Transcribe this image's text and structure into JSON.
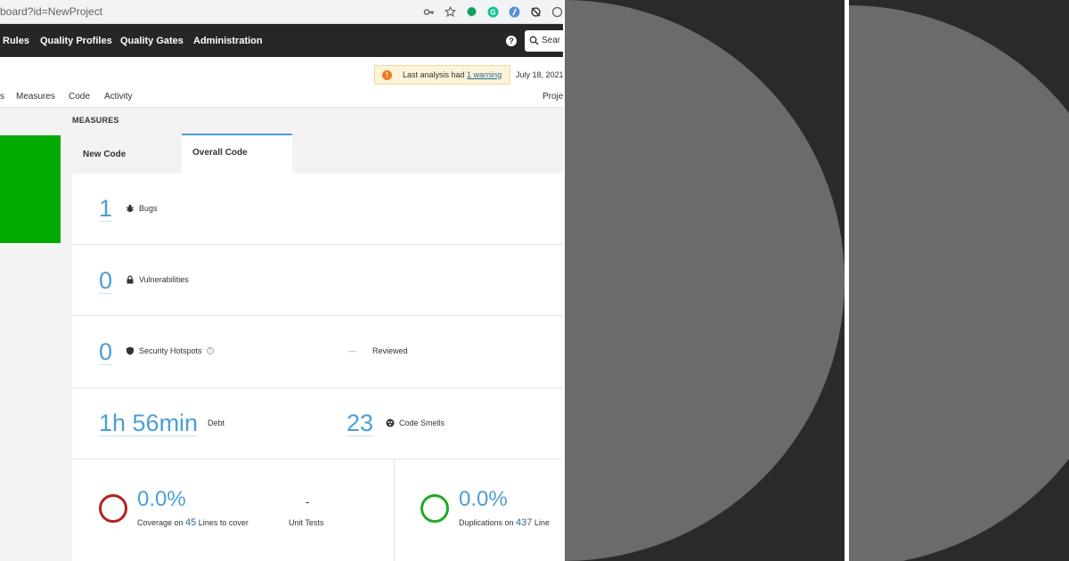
{
  "browser": {
    "url": "board?id=NewProject"
  },
  "nav": {
    "items": [
      "Rules",
      "Quality Profiles",
      "Quality Gates",
      "Administration"
    ],
    "search_placeholder": "Sear"
  },
  "header": {
    "warning_prefix": "Last analysis had ",
    "warning_link": "1 warning",
    "analysis_date": "July 18, 2021",
    "tabs": [
      "s",
      "Measures",
      "Code",
      "Activity"
    ],
    "project_link": "Proje"
  },
  "measures": {
    "title": "MEASURES",
    "tabs": {
      "new_code": "New Code",
      "overall_code": "Overall Code"
    },
    "bugs": {
      "value": "1",
      "label": "Bugs"
    },
    "vulnerabilities": {
      "value": "0",
      "label": "Vulnerabilities"
    },
    "hotspots": {
      "value": "0",
      "label": "Security Hotspots",
      "reviewed_value": "—",
      "reviewed_label": "Reviewed"
    },
    "debt": {
      "value": "1h 56min",
      "label": "Debt"
    },
    "code_smells": {
      "value": "23",
      "label": "Code Smells"
    },
    "coverage": {
      "value": "0.0%",
      "prefix": "Coverage on ",
      "lines": "45",
      "suffix": " Lines to cover",
      "unit_tests_value": "-",
      "unit_tests_label": "Unit Tests"
    },
    "duplications": {
      "value": "0.0%",
      "prefix": "Duplications on ",
      "lines": "437",
      "suffix": " Line"
    }
  },
  "colors": {
    "quality_gate_pass": "#00aa00",
    "accent": "#4b9fd5",
    "coverage_ring": "#b22222",
    "duplication_ring": "#22aa22",
    "panel_bg": "#2a2a2a",
    "circle": "#6b6b6b"
  }
}
